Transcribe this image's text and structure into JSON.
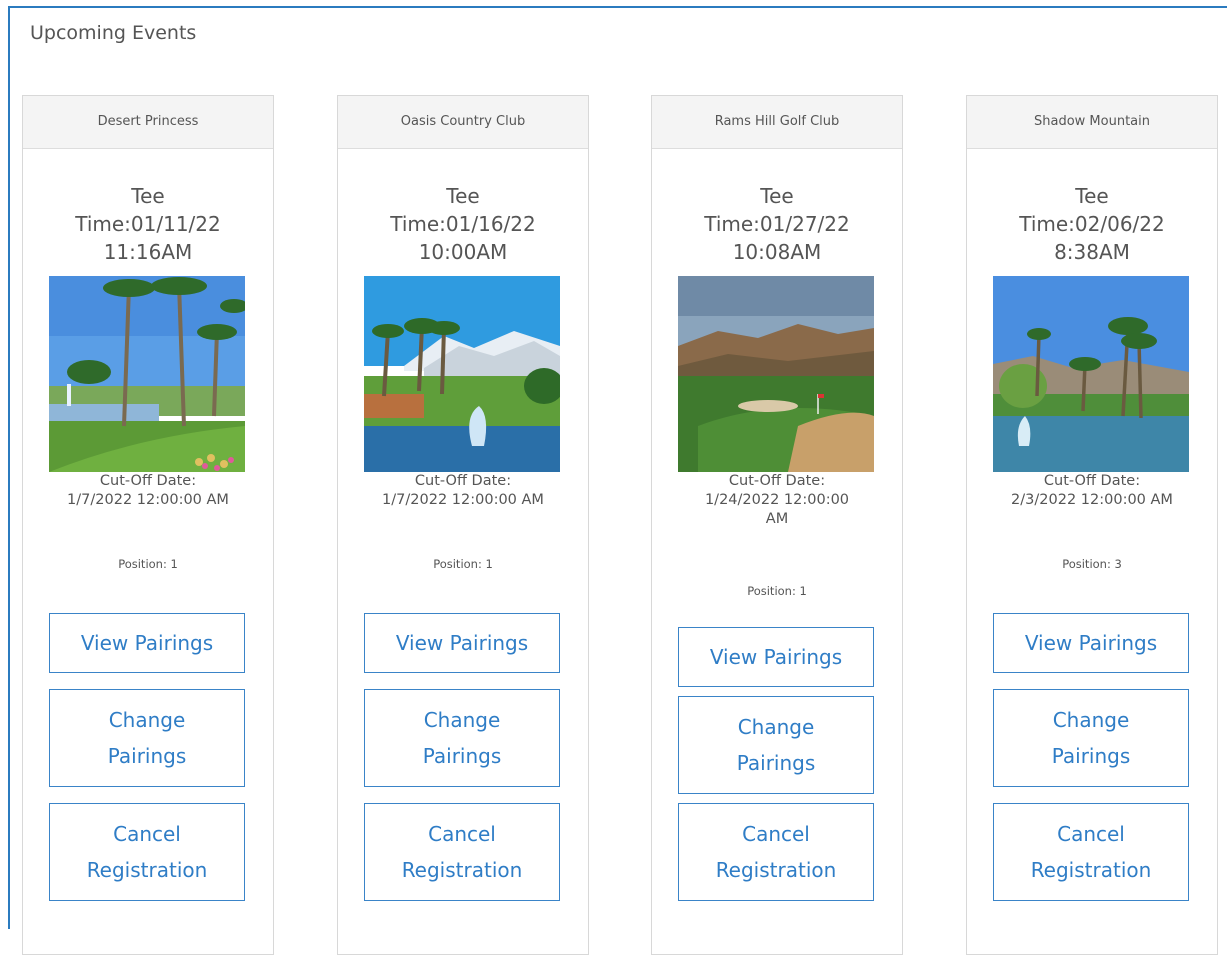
{
  "page": {
    "title": "Upcoming Events"
  },
  "events": [
    {
      "course": "Desert Princess",
      "tee_line1": "Tee",
      "tee_line2": "Time:01/11/22",
      "tee_line3": "11:16AM",
      "cutoff_label": "Cut-Off Date:",
      "cutoff_value": "1/7/2022 12:00:00 AM",
      "position": "Position: 1",
      "view_label": "View Pairings",
      "change_line1": "Change",
      "change_line2": "Pairings",
      "cancel_line1": "Cancel",
      "cancel_line2": "Registration"
    },
    {
      "course": "Oasis Country Club",
      "tee_line1": "Tee",
      "tee_line2": "Time:01/16/22",
      "tee_line3": "10:00AM",
      "cutoff_label": "Cut-Off Date:",
      "cutoff_value": "1/7/2022 12:00:00 AM",
      "position": "Position: 1",
      "view_label": "View Pairings",
      "change_line1": "Change",
      "change_line2": "Pairings",
      "cancel_line1": "Cancel",
      "cancel_line2": "Registration"
    },
    {
      "course": "Rams Hill Golf Club",
      "tee_line1": "Tee",
      "tee_line2": "Time:01/27/22",
      "tee_line3": "10:08AM",
      "cutoff_label": "Cut-Off Date:",
      "cutoff_value_line1": "1/24/2022 12:00:00",
      "cutoff_value_line2": "AM",
      "position": "Position: 1",
      "view_label": "View Pairings",
      "change_line1": "Change",
      "change_line2": "Pairings",
      "cancel_line1": "Cancel",
      "cancel_line2": "Registration"
    },
    {
      "course": "Shadow Mountain",
      "tee_line1": "Tee",
      "tee_line2": "Time:02/06/22",
      "tee_line3": "8:38AM",
      "cutoff_label": "Cut-Off Date:",
      "cutoff_value": "2/3/2022 12:00:00 AM",
      "position": "Position: 3",
      "view_label": "View Pairings",
      "change_line1": "Change",
      "change_line2": "Pairings",
      "cancel_line1": "Cancel",
      "cancel_line2": "Registration"
    }
  ],
  "colors": {
    "accent": "#2f7dc6",
    "frame_border": "#2b7bbf",
    "header_bg": "#f4f4f4"
  }
}
